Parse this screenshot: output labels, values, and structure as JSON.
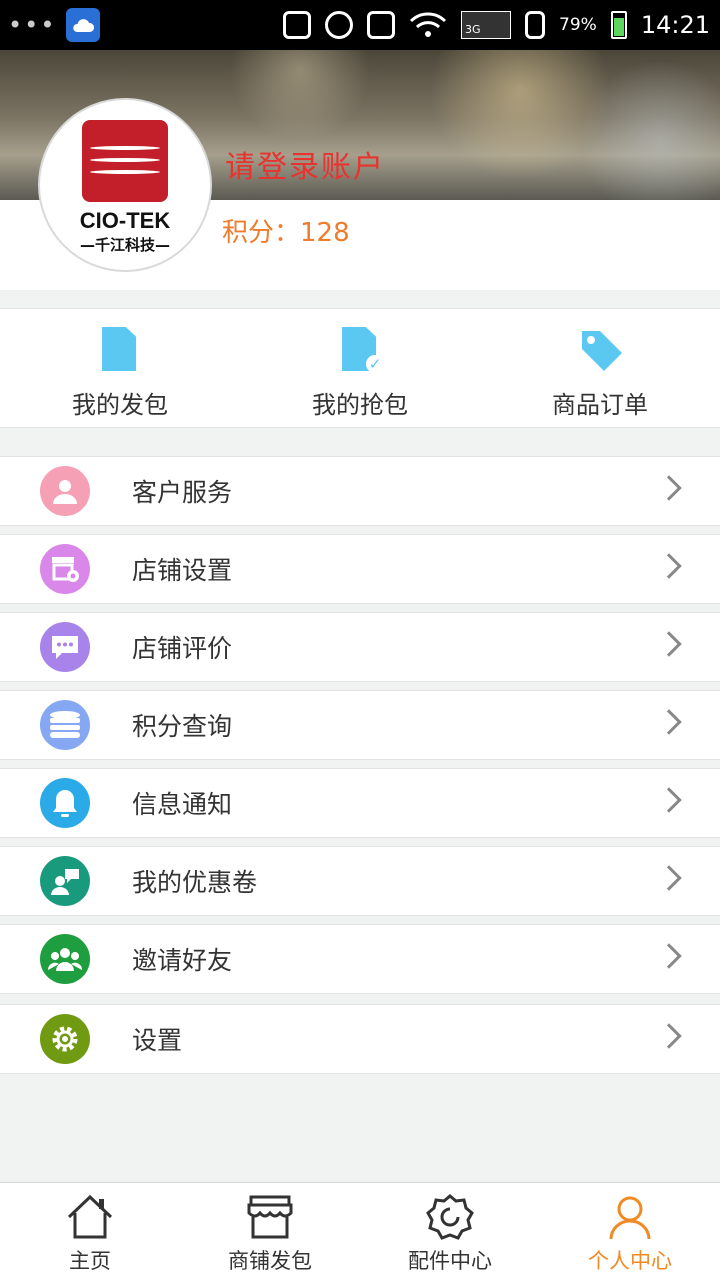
{
  "status_bar": {
    "dots": "•••",
    "network": "3G",
    "battery": "79%",
    "time": "14:21"
  },
  "profile": {
    "logo_text": "CIO-TEK",
    "logo_subtext": "—千江科技—",
    "login_prompt": "请登录账户",
    "points_label": "积分：",
    "points_value": "128"
  },
  "quick_tabs": [
    {
      "label": "我的发包",
      "icon": "document-icon"
    },
    {
      "label": "我的抢包",
      "icon": "document-check-icon"
    },
    {
      "label": "商品订单",
      "icon": "tag-icon"
    }
  ],
  "menu": [
    {
      "label": "客户服务",
      "icon": "customer-service-icon",
      "color": "#f5a0b5"
    },
    {
      "label": "店铺设置",
      "icon": "store-settings-icon",
      "color": "#d987e8"
    },
    {
      "label": "店铺评价",
      "icon": "chat-bubble-icon",
      "color": "#a884ea"
    },
    {
      "label": "积分查询",
      "icon": "points-stack-icon",
      "color": "#86a8f2"
    },
    {
      "label": "信息通知",
      "icon": "bell-icon",
      "color": "#2aaae6"
    },
    {
      "label": "我的优惠卷",
      "icon": "coupon-icon",
      "color": "#1a9a7c"
    },
    {
      "label": "邀请好友",
      "icon": "invite-friends-icon",
      "color": "#1e9e3e"
    },
    {
      "label": "设置",
      "icon": "gear-icon",
      "color": "#6f9a12"
    }
  ],
  "bottom_nav": [
    {
      "label": "主页",
      "icon": "home-icon"
    },
    {
      "label": "商铺发包",
      "icon": "shop-icon"
    },
    {
      "label": "配件中心",
      "icon": "parts-gear-icon"
    },
    {
      "label": "个人中心",
      "icon": "person-icon"
    }
  ],
  "colors": {
    "login_prompt": "#e8332f",
    "points": "#ef7b2c",
    "nav_active": "#f08a24",
    "quick_icon": "#5bc8f2"
  }
}
